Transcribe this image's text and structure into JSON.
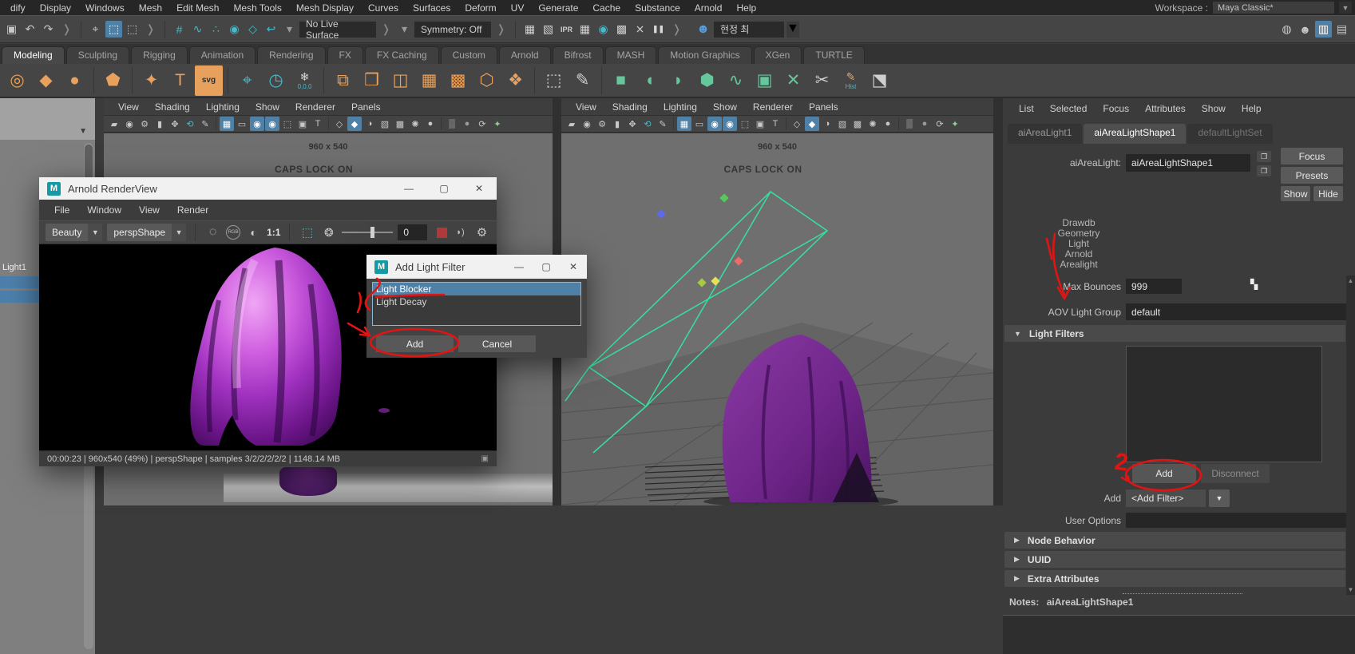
{
  "colors": {
    "accent": "#4f81a6",
    "teal": "#49b8c8",
    "orange": "#e8a15c",
    "green": "#66c79c",
    "annotation": "#e11414",
    "viewport": "#6f6f6f",
    "selection_blue": "#4f81a6"
  },
  "menubar": {
    "items": [
      "dify",
      "Display",
      "Windows",
      "Mesh",
      "Edit Mesh",
      "Mesh Tools",
      "Mesh Display",
      "Curves",
      "Surfaces",
      "Deform",
      "UV",
      "Generate",
      "Cache",
      "Substance",
      "Arnold",
      "Help"
    ],
    "workspace_label": "Workspace :",
    "workspace_value": "Maya Classic*"
  },
  "toolbar": {
    "icons_a": [
      {
        "n": "window-icon",
        "g": "▣",
        "c": "#c8c8c8"
      },
      {
        "n": "undo-icon",
        "g": "↶",
        "c": "#c8c8c8"
      },
      {
        "n": "redo-icon",
        "g": "↷",
        "c": "#c8c8c8"
      },
      {
        "n": "chevron-icon",
        "g": "❭",
        "c": "#8a8a8a"
      },
      {
        "sep": true
      },
      {
        "n": "select-lasso-icon",
        "g": "⌖",
        "c": "#c8c8c8"
      },
      {
        "n": "select-object-icon",
        "g": "⬚",
        "c": "#ffffff",
        "a": true
      },
      {
        "n": "select-component-icon",
        "g": "⬚",
        "c": "#c8c8c8"
      },
      {
        "n": "chevron-icon",
        "g": "❭",
        "c": "#8a8a8a"
      },
      {
        "sep": true
      },
      {
        "n": "snap-grid-icon",
        "g": "#",
        "c": "#49b8c8"
      },
      {
        "n": "snap-curve-icon",
        "g": "∿",
        "c": "#49b8c8"
      },
      {
        "n": "snap-point-icon",
        "g": "∴",
        "c": "#49b8c8"
      },
      {
        "n": "snap-projected-center-icon",
        "g": "◉",
        "c": "#49b8c8"
      },
      {
        "n": "snap-plane-icon",
        "g": "◇",
        "c": "#49b8c8"
      },
      {
        "n": "snap-history-icon",
        "g": "↩",
        "c": "#49b8c8"
      },
      {
        "n": "caret-icon",
        "g": "▾",
        "c": "#9a9a9a"
      }
    ],
    "no_live_surface": "No Live Surface",
    "icons_b": [
      {
        "n": "chevron-icon",
        "g": "❭",
        "c": "#8a8a8a"
      },
      {
        "n": "caret-icon",
        "g": "▾",
        "c": "#9a9a9a"
      }
    ],
    "symmetry": "Symmetry: Off",
    "icons_c": [
      {
        "n": "chevron-icon",
        "g": "❭",
        "c": "#8a8a8a"
      },
      {
        "sep": true
      },
      {
        "n": "render-frame-icon",
        "g": "▦",
        "c": "#cfcfcf"
      },
      {
        "n": "render-region-icon",
        "g": "▧",
        "c": "#cfcfcf"
      },
      {
        "n": "ipr-render-icon",
        "g": "IPR",
        "c": "#cfcfcf",
        "lbl": true
      },
      {
        "n": "render-settings-icon",
        "g": "▦",
        "c": "#cfcfcf"
      },
      {
        "n": "display-render-icon",
        "g": "◉",
        "c": "#49b8c8"
      },
      {
        "n": "texture-view-icon",
        "g": "▩",
        "c": "#cfcfcf"
      },
      {
        "n": "paint-effects-icon",
        "g": "⨯",
        "c": "#cfcfcf"
      },
      {
        "n": "pause-icon",
        "g": "❚❚",
        "c": "#d8d8d8",
        "lbl": true
      },
      {
        "n": "chevron-icon",
        "g": "❭",
        "c": "#8a8a8a"
      }
    ],
    "user_icon": {
      "n": "user-avatar-icon",
      "g": "☻",
      "c": "#5b9bd5"
    },
    "user_name": "현정 최",
    "icons_right": [
      {
        "n": "scene-layout-icon",
        "g": "◍",
        "c": "#c8c8c8"
      },
      {
        "n": "character-panel-icon",
        "g": "☻",
        "c": "#c8c8c8"
      },
      {
        "n": "attribute-editor-toggle-icon",
        "g": "▥",
        "c": "#ffffff",
        "a": true
      },
      {
        "n": "channel-box-toggle-icon",
        "g": "▤",
        "c": "#c8c8c8"
      }
    ]
  },
  "shelf_tabs": [
    {
      "label": "Modeling",
      "active": true
    },
    {
      "label": "Sculpting"
    },
    {
      "label": "Rigging"
    },
    {
      "label": "Animation"
    },
    {
      "label": "Rendering"
    },
    {
      "label": "FX"
    },
    {
      "label": "FX Caching"
    },
    {
      "label": "Custom"
    },
    {
      "label": "Arnold"
    },
    {
      "label": "Bifrost"
    },
    {
      "label": "MASH"
    },
    {
      "label": "Motion Graphics"
    },
    {
      "label": "XGen"
    },
    {
      "label": "TURTLE"
    }
  ],
  "shelf_icons": [
    {
      "n": "poly-torus-icon",
      "g": "◎",
      "c": "#e8a15c"
    },
    {
      "n": "poly-diamond-icon",
      "g": "◆",
      "c": "#e8a15c"
    },
    {
      "n": "poly-sphere-icon",
      "g": "●",
      "c": "#e8a15c"
    },
    {
      "sep": true
    },
    {
      "n": "platonic-solid-icon",
      "g": "⬟",
      "c": "#e8a15c"
    },
    {
      "sep": true
    },
    {
      "n": "super-shape-icon",
      "g": "✦",
      "c": "#e8a15c"
    },
    {
      "n": "type-tool-icon",
      "g": "T",
      "c": "#e8a15c"
    },
    {
      "n": "svg-tool-icon",
      "g": "svg",
      "c": "#2f2f2f",
      "bg": "#e8a15c",
      "lbl": true
    },
    {
      "sep": true
    },
    {
      "n": "measure-tool-icon",
      "g": "⌖",
      "c": "#49b8c8"
    },
    {
      "n": "animated-sweep-icon",
      "g": "◷",
      "c": "#49b8c8"
    },
    {
      "n": "zero-transform-icon",
      "g": "❄",
      "c": "#d8d8d8",
      "sub": "0,0,0"
    },
    {
      "sep": true
    },
    {
      "n": "booleans-icon",
      "g": "⧉",
      "c": "#e8a15c"
    },
    {
      "n": "combine-icon",
      "g": "❒",
      "c": "#e8a15c"
    },
    {
      "n": "mirror-icon",
      "g": "◫",
      "c": "#e8a15c"
    },
    {
      "n": "smooth-icon",
      "g": "▦",
      "c": "#e8a15c"
    },
    {
      "n": "subdiv-icon",
      "g": "▩",
      "c": "#e8a15c"
    },
    {
      "n": "bevel-icon",
      "g": "⬡",
      "c": "#e8a15c"
    },
    {
      "n": "multi-cut-icon",
      "g": "❖",
      "c": "#e8a15c"
    },
    {
      "sep": true
    },
    {
      "n": "frame-icon",
      "g": "⬚",
      "c": "#cfcfcf"
    },
    {
      "n": "sculpt-pen-icon",
      "g": "✎",
      "c": "#cfcfcf"
    },
    {
      "sep": true
    },
    {
      "n": "uv-plane-icon",
      "g": "■",
      "c": "#66c79c"
    },
    {
      "n": "uv-cylinder-icon",
      "g": "◖",
      "c": "#66c79c"
    },
    {
      "n": "uv-sphere-icon",
      "g": "◗",
      "c": "#66c79c"
    },
    {
      "n": "uv-cube-icon",
      "g": "⬢",
      "c": "#66c79c"
    },
    {
      "n": "uv-contour-icon",
      "g": "∿",
      "c": "#66c79c"
    },
    {
      "n": "uv-editor-icon",
      "g": "▣",
      "c": "#66c79c"
    },
    {
      "n": "uv-cut-icon",
      "g": "✕",
      "c": "#66c79c"
    },
    {
      "n": "uv-sew-icon",
      "g": "✂",
      "c": "#cfcfcf"
    },
    {
      "n": "hist-icon",
      "g": "✎",
      "c": "#e8a15c",
      "sub": "Hist"
    },
    {
      "n": "layered-texture-icon",
      "g": "⬔",
      "c": "#cfcfcf"
    }
  ],
  "outliner": {
    "item": "Light1"
  },
  "viewport": {
    "menus": [
      "View",
      "Shading",
      "Lighting",
      "Show",
      "Renderer",
      "Panels"
    ],
    "icons": [
      {
        "n": "view-cube-icon",
        "g": "▰",
        "c": "#c8c8c8"
      },
      {
        "n": "camera-icon",
        "g": "◉",
        "c": "#c8c8c8"
      },
      {
        "n": "camera-settings-icon",
        "g": "⚙",
        "c": "#c8c8c8"
      },
      {
        "n": "bookmark-icon",
        "g": "▮",
        "c": "#c8c8c8"
      },
      {
        "n": "pan-zoom-icon",
        "g": "✥",
        "c": "#c8c8c8"
      },
      {
        "n": "orbit-icon",
        "g": "⟲",
        "c": "#49b8c8"
      },
      {
        "n": "pencil-icon",
        "g": "✎",
        "c": "#c8c8c8"
      },
      {
        "sep": true
      },
      {
        "n": "grid-toggle-icon",
        "g": "▦",
        "c": "#ffffff",
        "a": true
      },
      {
        "n": "film-gate-icon",
        "g": "▭",
        "c": "#c8c8c8"
      },
      {
        "n": "resolution-gate-icon",
        "g": "◉",
        "c": "#ffffff",
        "a": true
      },
      {
        "n": "gate-mask-icon",
        "g": "◉",
        "c": "#ffffff",
        "a": true
      },
      {
        "n": "safe-action-icon",
        "g": "⬚",
        "c": "#c8c8c8"
      },
      {
        "n": "image-plane-icon",
        "g": "▣",
        "c": "#c8c8c8"
      },
      {
        "n": "hud-text-icon",
        "g": "T",
        "c": "#c8c8c8"
      },
      {
        "sep": true
      },
      {
        "n": "wireframe-icon",
        "g": "◇",
        "c": "#c8c8c8"
      },
      {
        "n": "shaded-icon",
        "g": "◆",
        "c": "#ffffff",
        "a": true
      },
      {
        "n": "shaded-wire-icon",
        "g": "◑",
        "c": "#c8c8c8"
      },
      {
        "n": "textured-icon",
        "g": "▧",
        "c": "#c8c8c8"
      },
      {
        "n": "checker-icon",
        "g": "▩",
        "c": "#c8c8c8"
      },
      {
        "n": "lights-icon",
        "g": "✺",
        "c": "#c8c8c8"
      },
      {
        "n": "shadows-icon",
        "g": "●",
        "c": "#c8c8c8"
      },
      {
        "sep": true
      },
      {
        "n": "ao-icon",
        "g": "▒",
        "c": "#c8c8c8"
      },
      {
        "n": "aa-icon",
        "g": "●",
        "c": "#9a9a9a"
      },
      {
        "n": "refresh-icon",
        "g": "⟳",
        "c": "#c8c8c8"
      },
      {
        "n": "exposure-icon",
        "g": "✦",
        "c": "#8fd18f"
      }
    ],
    "resolution": "960 x 540",
    "caps": "CAPS LOCK ON"
  },
  "renderview": {
    "logo": "M",
    "title": "Arnold RenderView",
    "minimize": "—",
    "maximize": "▢",
    "close": "✕",
    "menus": [
      "File",
      "Window",
      "View",
      "Render"
    ],
    "aov_value": "Beauty",
    "camera_value": "perspShape",
    "rgb_label": "RGB",
    "zoom_label": "1:1",
    "exposure_value": "0",
    "status": "00:00:23 | 960x540 (49%) | perspShape  | samples 3/2/2/2/2/2 | 1148.14 MB"
  },
  "dialog": {
    "logo": "M",
    "title": "Add Light Filter",
    "minimize": "—",
    "maximize": "▢",
    "close": "✕",
    "options": [
      {
        "label": "Light Blocker",
        "selected": true
      },
      {
        "label": "Light Decay"
      }
    ],
    "add_label": "Add",
    "cancel_label": "Cancel"
  },
  "attribute_editor": {
    "menus": [
      "List",
      "Selected",
      "Focus",
      "Attributes",
      "Show",
      "Help"
    ],
    "tabs": [
      {
        "label": "aiAreaLight1"
      },
      {
        "label": "aiAreaLightShape1",
        "active": true
      },
      {
        "label": "defaultLightSet",
        "dim": true
      }
    ],
    "name_label": "aiAreaLight:",
    "name_value": "aiAreaLightShape1",
    "focus_button": "Focus",
    "presets_button": "Presets",
    "show_button": "Show",
    "hide_button": "Hide",
    "hierarchy": [
      "Drawdb",
      "Geometry",
      "Light",
      "Arnold",
      "Arealight"
    ],
    "max_bounces_label": "Max Bounces",
    "max_bounces_value": "999",
    "aov_label": "AOV Light Group",
    "aov_value": "default",
    "light_filters_label": "Light Filters",
    "add_button": "Add",
    "disconnect_button": "Disconnect",
    "add_filter_label": "Add",
    "add_filter_value": "<Add Filter>",
    "user_options_label": "User Options",
    "sections": [
      "Node Behavior",
      "UUID",
      "Extra Attributes"
    ],
    "notes_label": "Notes:",
    "notes_value": "aiAreaLightShape1"
  }
}
